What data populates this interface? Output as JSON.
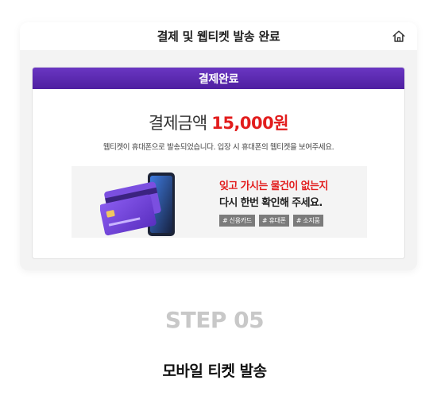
{
  "titlebar": {
    "title": "결제 및 웹티켓 발송 완료",
    "home_icon": "home-icon"
  },
  "receipt": {
    "header": "결제완료",
    "amount_label": "결제금액",
    "amount_value": "15,000원",
    "notice": "웹티켓이 휴대폰으로 발송되었습니다. 입장 시 휴대폰의 웹티켓을 보여주세요."
  },
  "promo": {
    "line1": "잊고 가시는 물건이 없는지",
    "line2": "다시 한번 확인해 주세요.",
    "tags": [
      "# 신용카드",
      "# 휴대폰",
      "# 소지품"
    ],
    "image_icon": "card-and-phone-illustration"
  },
  "step": {
    "label": "STEP 05",
    "caption": "모바일 티켓 발송"
  },
  "colors": {
    "header_purple": "#5b2ab0",
    "amount_red": "#e21d1d",
    "step_gray": "#c8c8c8"
  }
}
